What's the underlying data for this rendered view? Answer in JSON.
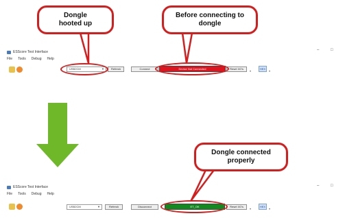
{
  "callouts": {
    "dongle_hooted": "Dongle hooted up",
    "before_connecting": "Before connecting to dongle",
    "dongle_connected": "Dongle connected properly"
  },
  "window": {
    "title": "ESScore Test Interface",
    "menu": [
      "File",
      "Tools",
      "Debug",
      "Help"
    ],
    "minimize": "–",
    "maximize": "□"
  },
  "toolbar_before": {
    "combo_value": "USB2CM",
    "refresh": "Refresh",
    "connect": "Connect",
    "status": "Device Not Connected",
    "reset": "Reset I/O's",
    "hex": "HEX"
  },
  "toolbar_after": {
    "combo_value": "USB2CM",
    "refresh": "Refresh",
    "connect": "Disconnect",
    "status": "ET_OK",
    "reset": "Reset I/O's",
    "hex": "HEX"
  },
  "colors": {
    "callout_border": "#d71c1c",
    "status_disconnected": "#e0141e",
    "status_connected": "#138a1f",
    "arrow": "#6fb82a"
  }
}
